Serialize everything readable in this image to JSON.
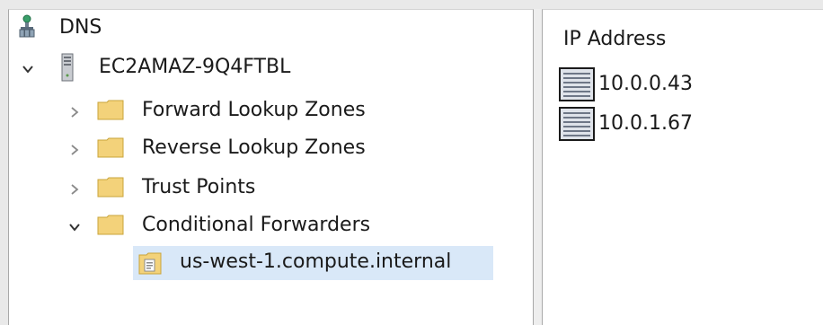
{
  "tree": {
    "root": {
      "label": "DNS",
      "icon": "dns-network-icon"
    },
    "server": {
      "label": "EC2AMAZ-9Q4FTBL",
      "icon": "server-icon",
      "expanded": true
    },
    "children": [
      {
        "label": "Forward Lookup Zones",
        "expanded": false
      },
      {
        "label": "Reverse Lookup Zones",
        "expanded": false
      },
      {
        "label": "Trust Points",
        "expanded": false
      },
      {
        "label": "Conditional Forwarders",
        "expanded": true
      }
    ],
    "forwarder": {
      "label": "us-west-1.compute.internal",
      "selected": true
    }
  },
  "details": {
    "column_header": "IP Address",
    "rows": [
      {
        "value": "10.0.0.43"
      },
      {
        "value": "10.0.1.67"
      }
    ]
  },
  "colors": {
    "selection": "#d9e8f8",
    "folder": "#f3d27a",
    "folder_edge": "#c9a43b"
  }
}
